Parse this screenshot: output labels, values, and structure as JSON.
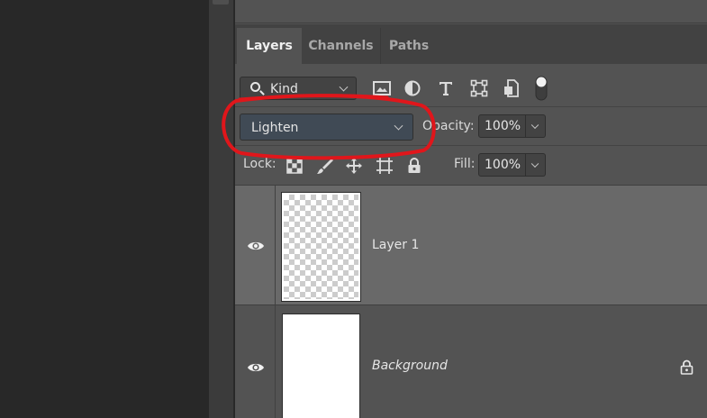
{
  "tabs": [
    {
      "label": "Layers",
      "active": true
    },
    {
      "label": "Channels",
      "active": false
    },
    {
      "label": "Paths",
      "active": false
    }
  ],
  "filter": {
    "kind_value": "Kind",
    "icons": [
      "image-filter-icon",
      "adjustment-filter-icon",
      "type-filter-icon",
      "shape-filter-icon",
      "smart-object-filter-icon",
      "filter-toggle-icon"
    ]
  },
  "blend": {
    "mode": "Lighten",
    "opacity_label": "Opacity:",
    "opacity_value": "100%"
  },
  "lock": {
    "label": "Lock:",
    "icons": [
      "lock-transparent-pixels-icon",
      "lock-image-pixels-icon",
      "lock-position-icon",
      "lock-artboard-icon",
      "lock-all-icon"
    ],
    "fill_label": "Fill:",
    "fill_value": "100%"
  },
  "layers": [
    {
      "name": "Layer 1",
      "selected": true,
      "visible": true,
      "thumbnail": "transparent",
      "locked": false
    },
    {
      "name": "Background",
      "selected": false,
      "visible": true,
      "thumbnail": "white",
      "locked": true
    }
  ],
  "colors": {
    "panel": "#535353",
    "selected_layer": "#696969",
    "annotation": "#e0161b",
    "blend_field": "#404a55"
  }
}
